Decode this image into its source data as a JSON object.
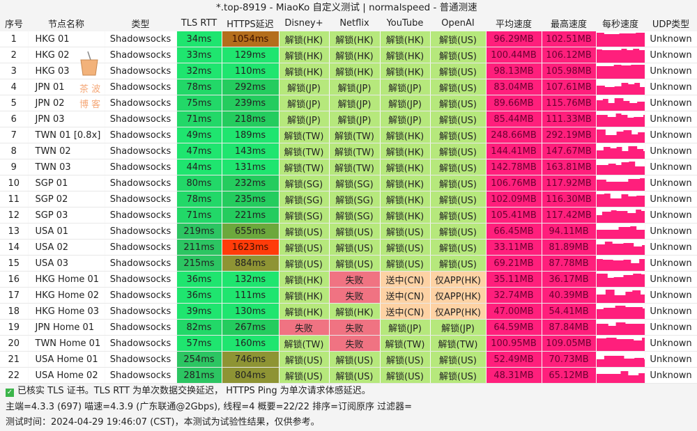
{
  "title": "*.top-8919 - MiaoKo 自定义测试 | normalspeed - 普通测速",
  "headers": [
    "序号",
    "节点名称",
    "类型",
    "TLS RTT",
    "HTTPS延迟",
    "Disney+",
    "Netflix",
    "YouTube",
    "OpenAI",
    "平均速度",
    "最高速度",
    "每秒速度",
    "UDP类型"
  ],
  "colors": {
    "tls_green": "#1fe56f",
    "unlock": "#b6e87c",
    "fail": "#f07382",
    "pending": "#fdd2a4",
    "speed": "#ff1f7c",
    "https_mid": "#8c9a32",
    "https_high": "#b46e1c",
    "https_bad": "#ff3c0a"
  },
  "rows": [
    [
      "1",
      "HKG 01",
      "Shadowsocks",
      "34ms",
      "1054ms",
      "解锁(HK)",
      "解锁(HK)",
      "解锁(HK)",
      "解锁(US)",
      "96.29MB",
      "102.51MB",
      "Unknown"
    ],
    [
      "2",
      "HKG 02",
      "Shadowsocks",
      "33ms",
      "129ms",
      "解锁(HK)",
      "解锁(HK)",
      "解锁(HK)",
      "解锁(US)",
      "100.44MB",
      "106.12MB",
      "Unknown"
    ],
    [
      "3",
      "HKG 03",
      "Shadowsocks",
      "32ms",
      "110ms",
      "解锁(HK)",
      "解锁(HK)",
      "解锁(HK)",
      "解锁(US)",
      "98.13MB",
      "105.98MB",
      "Unknown"
    ],
    [
      "4",
      "JPN 01",
      "Shadowsocks",
      "78ms",
      "292ms",
      "解锁(JP)",
      "解锁(JP)",
      "解锁(JP)",
      "解锁(US)",
      "83.04MB",
      "107.61MB",
      "Unknown"
    ],
    [
      "5",
      "JPN 02",
      "Shadowsocks",
      "75ms",
      "239ms",
      "解锁(JP)",
      "解锁(JP)",
      "解锁(JP)",
      "解锁(US)",
      "89.66MB",
      "115.76MB",
      "Unknown"
    ],
    [
      "6",
      "JPN 03",
      "Shadowsocks",
      "71ms",
      "218ms",
      "解锁(JP)",
      "解锁(JP)",
      "解锁(JP)",
      "解锁(US)",
      "85.44MB",
      "111.33MB",
      "Unknown"
    ],
    [
      "7",
      "TWN 01 [0.8x]",
      "Shadowsocks",
      "49ms",
      "189ms",
      "解锁(TW)",
      "解锁(TW)",
      "解锁(HK)",
      "解锁(US)",
      "248.66MB",
      "292.19MB",
      "Unknown"
    ],
    [
      "8",
      "TWN 02",
      "Shadowsocks",
      "47ms",
      "143ms",
      "解锁(TW)",
      "解锁(TW)",
      "解锁(HK)",
      "解锁(US)",
      "144.41MB",
      "147.67MB",
      "Unknown"
    ],
    [
      "9",
      "TWN 03",
      "Shadowsocks",
      "44ms",
      "131ms",
      "解锁(TW)",
      "解锁(TW)",
      "解锁(HK)",
      "解锁(US)",
      "142.78MB",
      "163.81MB",
      "Unknown"
    ],
    [
      "10",
      "SGP 01",
      "Shadowsocks",
      "80ms",
      "232ms",
      "解锁(SG)",
      "解锁(SG)",
      "解锁(HK)",
      "解锁(US)",
      "106.76MB",
      "117.92MB",
      "Unknown"
    ],
    [
      "11",
      "SGP 02",
      "Shadowsocks",
      "78ms",
      "235ms",
      "解锁(SG)",
      "解锁(SG)",
      "解锁(HK)",
      "解锁(US)",
      "102.09MB",
      "116.30MB",
      "Unknown"
    ],
    [
      "12",
      "SGP 03",
      "Shadowsocks",
      "71ms",
      "221ms",
      "解锁(SG)",
      "解锁(SG)",
      "解锁(HK)",
      "解锁(US)",
      "105.41MB",
      "117.42MB",
      "Unknown"
    ],
    [
      "13",
      "USA 01",
      "Shadowsocks",
      "219ms",
      "655ms",
      "解锁(US)",
      "解锁(US)",
      "解锁(US)",
      "解锁(US)",
      "66.45MB",
      "94.11MB",
      "Unknown"
    ],
    [
      "14",
      "USA 02",
      "Shadowsocks",
      "211ms",
      "1623ms",
      "解锁(US)",
      "解锁(US)",
      "解锁(US)",
      "解锁(US)",
      "33.11MB",
      "81.89MB",
      "Unknown"
    ],
    [
      "15",
      "USA 03",
      "Shadowsocks",
      "215ms",
      "884ms",
      "解锁(US)",
      "解锁(US)",
      "解锁(US)",
      "解锁(US)",
      "69.21MB",
      "87.78MB",
      "Unknown"
    ],
    [
      "16",
      "HKG Home 01",
      "Shadowsocks",
      "36ms",
      "132ms",
      "解锁(HK)",
      "失败",
      "送中(CN)",
      "仅APP(HK)",
      "35.11MB",
      "36.17MB",
      "Unknown"
    ],
    [
      "17",
      "HKG Home 02",
      "Shadowsocks",
      "36ms",
      "111ms",
      "解锁(HK)",
      "失败",
      "送中(CN)",
      "仅APP(HK)",
      "32.74MB",
      "40.39MB",
      "Unknown"
    ],
    [
      "18",
      "HKG Home 03",
      "Shadowsocks",
      "39ms",
      "130ms",
      "解锁(HK)",
      "解锁(HK)",
      "送中(CN)",
      "仅APP(HK)",
      "47.00MB",
      "54.41MB",
      "Unknown"
    ],
    [
      "19",
      "JPN Home 01",
      "Shadowsocks",
      "82ms",
      "267ms",
      "失败",
      "失败",
      "解锁(JP)",
      "解锁(JP)",
      "64.59MB",
      "87.84MB",
      "Unknown"
    ],
    [
      "20",
      "TWN Home 01",
      "Shadowsocks",
      "57ms",
      "160ms",
      "解锁(TW)",
      "失败",
      "解锁(TW)",
      "解锁(TW)",
      "100.95MB",
      "109.05MB",
      "Unknown"
    ],
    [
      "21",
      "USA Home 01",
      "Shadowsocks",
      "254ms",
      "746ms",
      "解锁(US)",
      "解锁(US)",
      "解锁(US)",
      "解锁(US)",
      "52.49MB",
      "70.73MB",
      "Unknown"
    ],
    [
      "22",
      "USA Home 02",
      "Shadowsocks",
      "281ms",
      "804ms",
      "解锁(US)",
      "解锁(US)",
      "解锁(US)",
      "解锁(US)",
      "48.31MB",
      "65.12MB",
      "Unknown"
    ]
  ],
  "footer": {
    "line1": "已核实 TLS 证书。TLS RTT 为单次数据交换延迟， HTTPS Ping 为单次请求体感延迟。",
    "line2": "主端=4.3.3 (697) 喵速=4.3.9 (广东联通@2Gbps), 线程=4 概要=22/22 排序=订阅原序 过滤器=",
    "line3": "测试时间：2024-04-29 19:46:07 (CST)，本测试为试验性结果，仅供参考。"
  },
  "watermark": "茶波博客"
}
